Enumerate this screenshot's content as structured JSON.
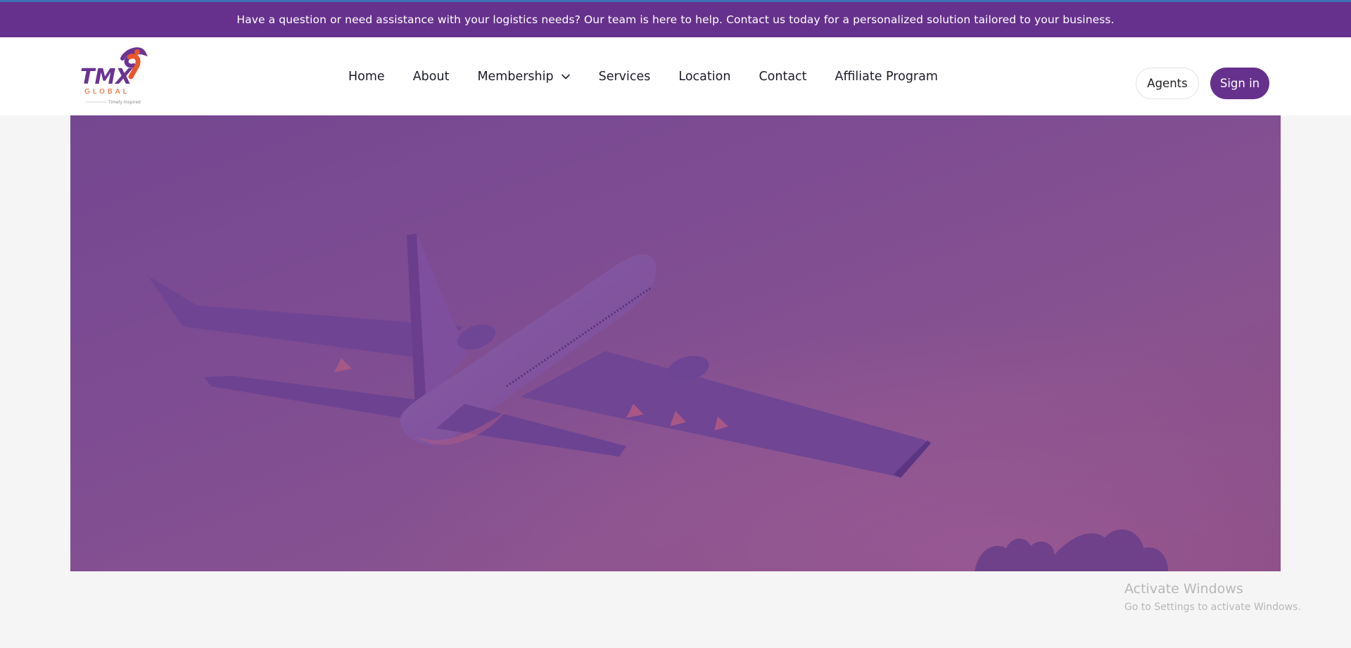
{
  "announcement": {
    "text": "Have a question or need assistance with your logistics needs? Our team is here to help. Contact us today for a personalized solution tailored to your business."
  },
  "logo": {
    "main": "TMX",
    "sub": "GLOBAL",
    "tagline": "Timely Inspired"
  },
  "nav": {
    "home": "Home",
    "about": "About",
    "membership": "Membership",
    "services": "Services",
    "location": "Location",
    "contact": "Contact",
    "affiliate": "Affiliate Program"
  },
  "buttons": {
    "agents": "Agents",
    "signin": "Sign in"
  },
  "watermark": {
    "title": "Activate Windows",
    "subtitle": "Go to Settings to activate Windows."
  },
  "colors": {
    "brand_purple": "#66318c",
    "logo_orange": "#e8562a",
    "hero_tint": "#7e4c93"
  }
}
